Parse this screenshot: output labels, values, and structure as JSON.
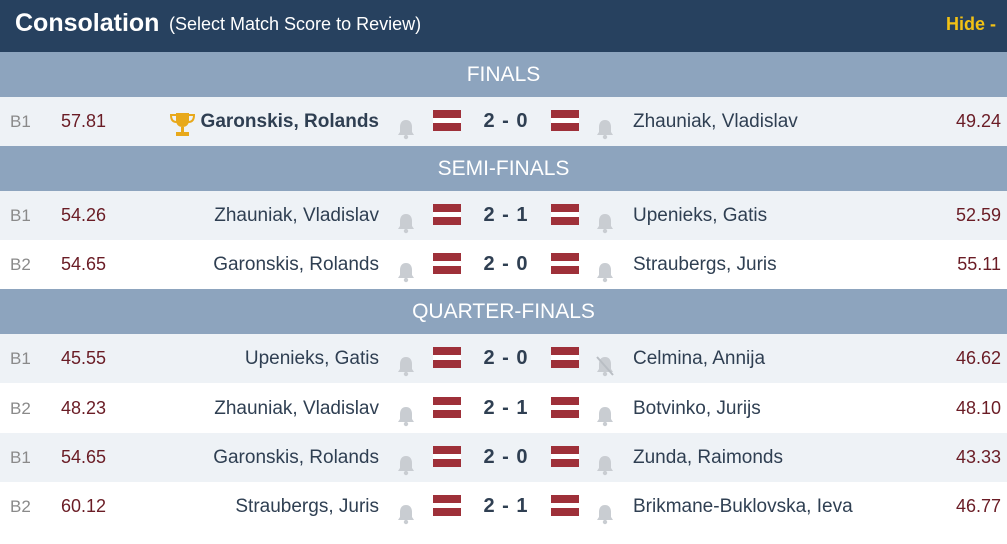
{
  "header": {
    "title": "Consolation",
    "subtitle": "(Select Match Score to Review)",
    "hide_label": "Hide -"
  },
  "colors": {
    "header_bg": "#27415f",
    "section_bg": "#8da4be",
    "hide_color": "#f2c114",
    "score_color": "#6a1c25",
    "flag_red": "#9e3039"
  },
  "sections": {
    "finals": "FINALS",
    "semi": "SEMI-FINALS",
    "quarter": "QUARTER-FINALS"
  },
  "matches": [
    {
      "bracket": "B1",
      "left_score": "57.81",
      "left_name": "Garonskis, Rolands",
      "result": "2 - 0",
      "right_name": "Zhauniak, Vladislav",
      "right_score": "49.24",
      "left_winner_trophy": true,
      "right_bell_muted": false
    },
    {
      "bracket": "B1",
      "left_score": "54.26",
      "left_name": "Zhauniak, Vladislav",
      "result": "2 - 1",
      "right_name": "Upenieks, Gatis",
      "right_score": "52.59",
      "left_winner_trophy": false,
      "right_bell_muted": false
    },
    {
      "bracket": "B2",
      "left_score": "54.65",
      "left_name": "Garonskis, Rolands",
      "result": "2 - 0",
      "right_name": "Straubergs, Juris",
      "right_score": "55.11",
      "left_winner_trophy": false,
      "right_bell_muted": false
    },
    {
      "bracket": "B1",
      "left_score": "45.55",
      "left_name": "Upenieks, Gatis",
      "result": "2 - 0",
      "right_name": "Celmina, Annija",
      "right_score": "46.62",
      "left_winner_trophy": false,
      "right_bell_muted": true
    },
    {
      "bracket": "B2",
      "left_score": "48.23",
      "left_name": "Zhauniak, Vladislav",
      "result": "2 - 1",
      "right_name": "Botvinko, Jurijs",
      "right_score": "48.10",
      "left_winner_trophy": false,
      "right_bell_muted": false
    },
    {
      "bracket": "B1",
      "left_score": "54.65",
      "left_name": "Garonskis, Rolands",
      "result": "2 - 0",
      "right_name": "Zunda, Raimonds",
      "right_score": "43.33",
      "left_winner_trophy": false,
      "right_bell_muted": false
    },
    {
      "bracket": "B2",
      "left_score": "60.12",
      "left_name": "Straubergs, Juris",
      "result": "2 - 1",
      "right_name": "Brikmane-Buklovska, Ieva",
      "right_score": "46.77",
      "left_winner_trophy": false,
      "right_bell_muted": false
    }
  ]
}
